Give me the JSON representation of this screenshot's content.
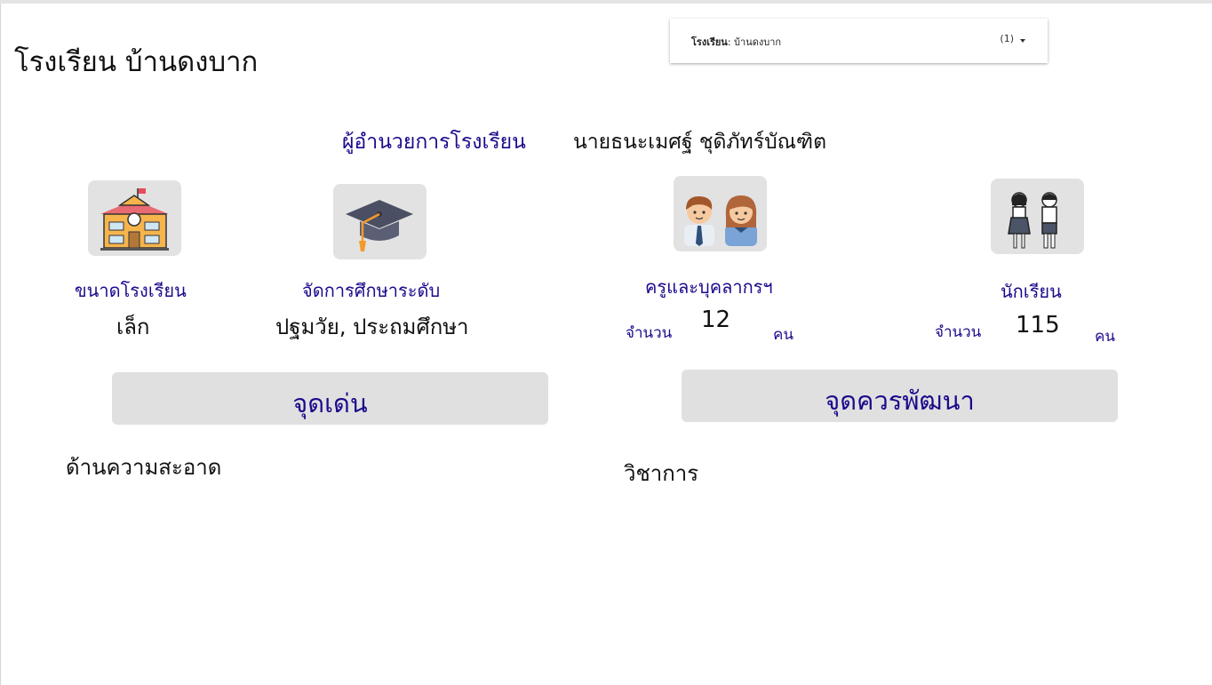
{
  "page": {
    "title": "โรงเรียน บ้านดงบาก"
  },
  "filter": {
    "label": "โรงเรียน",
    "value": "บ้านดงบาก",
    "count": "(1)"
  },
  "director": {
    "label": "ผู้อำนวยการโรงเรียน",
    "name": "นายธนะเมศฐ์ ชุดิภัทร์บัณฑิต"
  },
  "cards": {
    "size": {
      "label": "ขนาดโรงเรียน",
      "value": "เล็ก",
      "icon": "school-building-icon"
    },
    "level": {
      "label": "จัดการศึกษาระดับ",
      "value": "ปฐมวัย, ประถมศึกษา",
      "icon": "graduation-cap-icon"
    },
    "teachers": {
      "label": "ครูและบุคลากรฯ",
      "prefix": "จำนวน",
      "count": "12",
      "unit": "คน",
      "icon": "teachers-icon"
    },
    "students": {
      "label": "นักเรียน",
      "prefix": "จำนวน",
      "count": "115",
      "unit": "คน",
      "icon": "students-icon"
    }
  },
  "strengths": {
    "title": "จุดเด่น",
    "text": "ด้านความสะอาด"
  },
  "improve": {
    "title": "จุดควรพัฒนา",
    "text": "วิชาการ"
  },
  "colors": {
    "accent": "#1a0a8c",
    "panel": "#e0e0e0",
    "icon_bg": "#e2e2e2"
  }
}
